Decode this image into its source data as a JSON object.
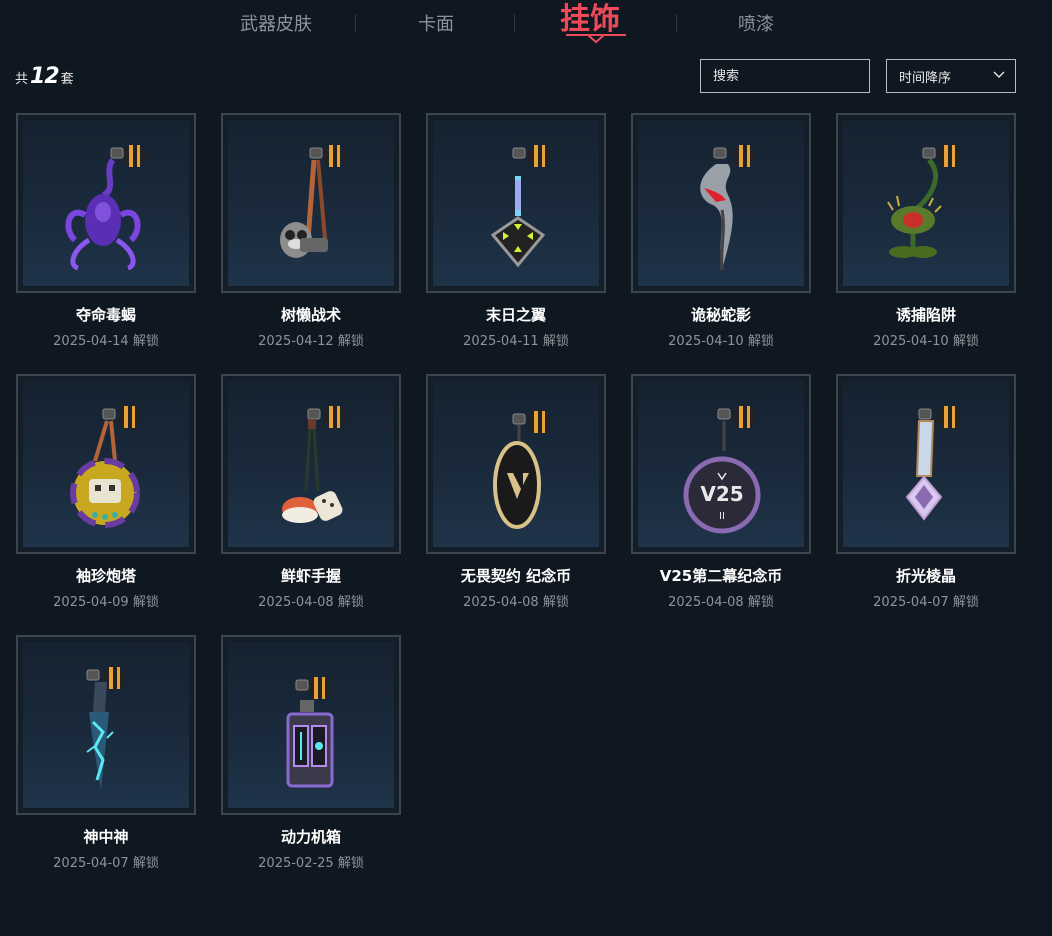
{
  "nav": {
    "tabs": [
      {
        "label": "武器皮肤"
      },
      {
        "label": "卡面"
      },
      {
        "label": "挂饰"
      },
      {
        "label": "喷漆"
      }
    ]
  },
  "summary": {
    "prefix": "共",
    "count": "12",
    "suffix": "套"
  },
  "search": {
    "placeholder": "搜索"
  },
  "sort": {
    "selected": "时间降序"
  },
  "items": [
    {
      "name": "夺命毒蝎",
      "date": "2025-04-14 解锁",
      "icon": "scorpion-charm-icon"
    },
    {
      "name": "树懒战术",
      "date": "2025-04-12 解锁",
      "icon": "sloth-charm-icon"
    },
    {
      "name": "末日之翼",
      "date": "2025-04-11 解锁",
      "icon": "doom-wing-charm-icon"
    },
    {
      "name": "诡秘蛇影",
      "date": "2025-04-10 解锁",
      "icon": "serpent-shadow-charm-icon"
    },
    {
      "name": "诱捕陷阱",
      "date": "2025-04-10 解锁",
      "icon": "flytrap-charm-icon"
    },
    {
      "name": "袖珍炮塔",
      "date": "2025-04-09 解锁",
      "icon": "pocket-turret-charm-icon"
    },
    {
      "name": "鲜虾手握",
      "date": "2025-04-08 解锁",
      "icon": "shrimp-sushi-charm-icon"
    },
    {
      "name": "无畏契约 纪念币",
      "date": "2025-04-08 解锁",
      "icon": "valorant-coin-charm-icon"
    },
    {
      "name": "V25第二幕纪念币",
      "date": "2025-04-08 解锁",
      "icon": "v25-coin-charm-icon"
    },
    {
      "name": "折光棱晶",
      "date": "2025-04-07 解锁",
      "icon": "prism-crystal-charm-icon"
    },
    {
      "name": "神中神",
      "date": "2025-04-07 解锁",
      "icon": "spectral-blade-charm-icon"
    },
    {
      "name": "动力机箱",
      "date": "2025-02-25 解锁",
      "icon": "power-box-charm-icon"
    }
  ],
  "colors": {
    "accent": "#ef4a5a",
    "background": "#0f1720",
    "card_border": "#3a4550",
    "muted_text": "#8c949b"
  }
}
